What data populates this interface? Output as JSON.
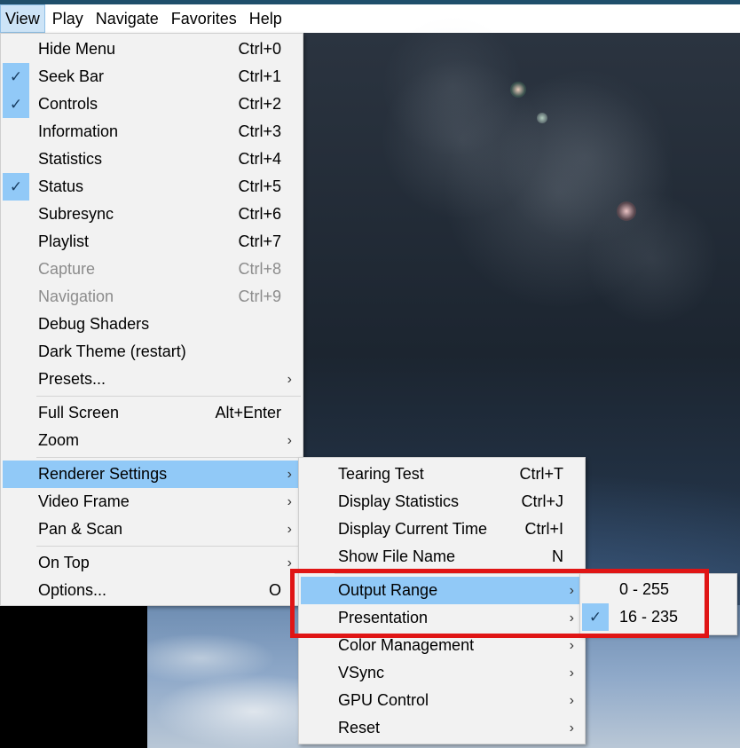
{
  "menubar": {
    "items": [
      "View",
      "Play",
      "Navigate",
      "Favorites",
      "Help"
    ]
  },
  "view_menu": {
    "items": [
      {
        "label": "Hide Menu",
        "shortcut": "Ctrl+0"
      },
      {
        "label": "Seek Bar",
        "shortcut": "Ctrl+1",
        "checked": true
      },
      {
        "label": "Controls",
        "shortcut": "Ctrl+2",
        "checked": true
      },
      {
        "label": "Information",
        "shortcut": "Ctrl+3"
      },
      {
        "label": "Statistics",
        "shortcut": "Ctrl+4"
      },
      {
        "label": "Status",
        "shortcut": "Ctrl+5",
        "checked": true
      },
      {
        "label": "Subresync",
        "shortcut": "Ctrl+6"
      },
      {
        "label": "Playlist",
        "shortcut": "Ctrl+7"
      },
      {
        "label": "Capture",
        "shortcut": "Ctrl+8",
        "disabled": true
      },
      {
        "label": "Navigation",
        "shortcut": "Ctrl+9",
        "disabled": true
      },
      {
        "label": "Debug Shaders",
        "shortcut": ""
      },
      {
        "label": "Dark Theme (restart)",
        "shortcut": ""
      },
      {
        "label": "Presets...",
        "submenu": true
      },
      {
        "label": "Full Screen",
        "shortcut": "Alt+Enter"
      },
      {
        "label": "Zoom",
        "submenu": true
      },
      {
        "label": "Renderer Settings",
        "submenu": true,
        "highlighted": true
      },
      {
        "label": "Video Frame",
        "submenu": true
      },
      {
        "label": "Pan & Scan",
        "submenu": true
      },
      {
        "label": "On Top",
        "submenu": true
      },
      {
        "label": "Options...",
        "shortcut": "O"
      }
    ]
  },
  "renderer_menu": {
    "items": [
      {
        "label": "Tearing Test",
        "shortcut": "Ctrl+T"
      },
      {
        "label": "Display Statistics",
        "shortcut": "Ctrl+J"
      },
      {
        "label": "Display Current Time",
        "shortcut": "Ctrl+I"
      },
      {
        "label": "Show File Name",
        "shortcut": "N"
      },
      {
        "label": "Output Range",
        "submenu": true,
        "highlighted": true
      },
      {
        "label": "Presentation",
        "submenu": true
      },
      {
        "label": "Color Management",
        "submenu": true
      },
      {
        "label": "VSync",
        "submenu": true
      },
      {
        "label": "GPU Control",
        "submenu": true
      },
      {
        "label": "Reset",
        "submenu": true
      }
    ]
  },
  "output_range_menu": {
    "items": [
      {
        "label": "0 - 255"
      },
      {
        "label": "16 - 235",
        "checked": true
      }
    ]
  },
  "glyphs": {
    "check": "✓",
    "arrow": "›"
  },
  "colors": {
    "highlight": "#91c9f7",
    "annotation": "#e01515"
  }
}
